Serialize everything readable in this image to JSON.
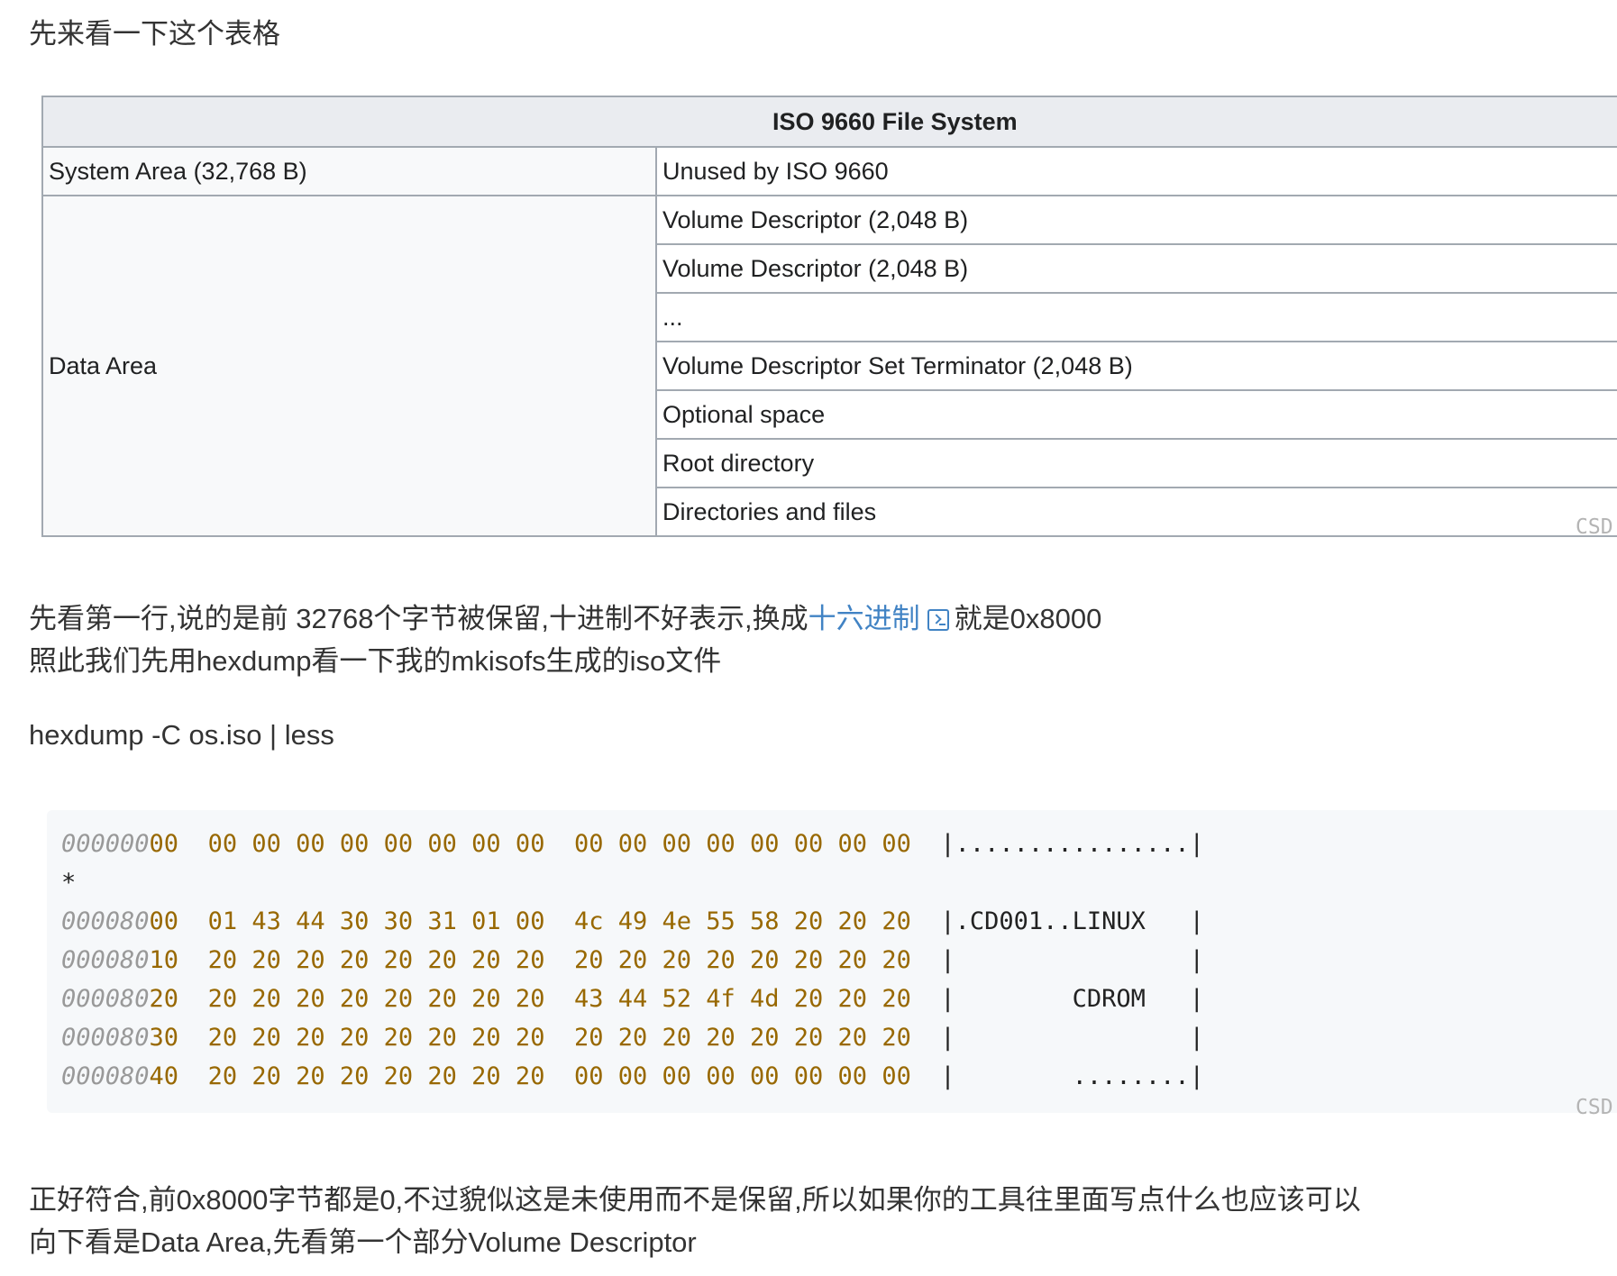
{
  "intro": "先来看一下这个表格",
  "table": {
    "title": "ISO 9660 File System",
    "system_area": "System Area (32,768 B)",
    "unused": "Unused by ISO 9660",
    "data_area": "Data Area",
    "data_rows": [
      "Volume Descriptor (2,048 B)",
      "Volume Descriptor (2,048 B)",
      "...",
      "Volume Descriptor Set Terminator (2,048 B)",
      "Optional space",
      "Root directory",
      "Directories and files"
    ]
  },
  "watermark": "CSD",
  "explain": {
    "line1_before": "先看第一行,说的是前 32768个字节被保留,十进制不好表示,换成",
    "line1_link": "十六进制",
    "line1_after": "就是0x8000",
    "line2": "照此我们先用hexdump看一下我的mkisofs生成的iso文件"
  },
  "command": "hexdump -C os.iso | less",
  "hexdump": [
    {
      "addr": "000000",
      "tail": "00",
      "hex": "  00 00 00 00 00 00 00 00  00 00 00 00 00 00 00 00  ",
      "ascii": "|................|"
    },
    {
      "addr": "",
      "tail": "",
      "hex": "",
      "ascii": "*"
    },
    {
      "addr": "000080",
      "tail": "00",
      "hex": "  01 43 44 30 30 31 01 00  4c 49 4e 55 58 20 20 20  ",
      "ascii": "|.CD001..LINUX   |"
    },
    {
      "addr": "000080",
      "tail": "10",
      "hex": "  20 20 20 20 20 20 20 20  20 20 20 20 20 20 20 20  ",
      "ascii": "|                |"
    },
    {
      "addr": "000080",
      "tail": "20",
      "hex": "  20 20 20 20 20 20 20 20  43 44 52 4f 4d 20 20 20  ",
      "ascii": "|        CDROM   |"
    },
    {
      "addr": "000080",
      "tail": "30",
      "hex": "  20 20 20 20 20 20 20 20  20 20 20 20 20 20 20 20  ",
      "ascii": "|                |"
    },
    {
      "addr": "000080",
      "tail": "40",
      "hex": "  20 20 20 20 20 20 20 20  00 00 00 00 00 00 00 00  ",
      "ascii": "|        ........|"
    }
  ],
  "conclusion": {
    "line1": "正好符合,前0x8000字节都是0,不过貌似这是未使用而不是保留,所以如果你的工具往里面写点什么也应该可以",
    "line2": "向下看是Data Area,先看第一个部分Volume Descriptor"
  }
}
